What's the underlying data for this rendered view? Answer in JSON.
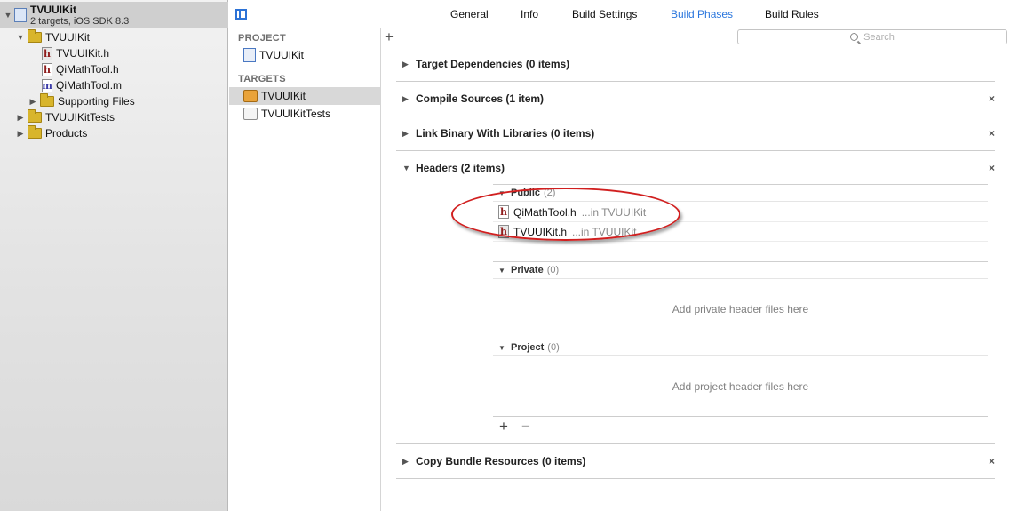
{
  "navigator": {
    "project_name": "TVUUIKit",
    "project_sub": "2 targets, iOS SDK 8.3",
    "items": [
      {
        "label": "TVUUIKit"
      },
      {
        "label": "TVUUIKit.h"
      },
      {
        "label": "QiMathTool.h"
      },
      {
        "label": "QiMathTool.m"
      },
      {
        "label": "Supporting Files"
      },
      {
        "label": "TVUUIKitTests"
      },
      {
        "label": "Products"
      }
    ]
  },
  "tabs": [
    {
      "label": "General"
    },
    {
      "label": "Info"
    },
    {
      "label": "Build Settings"
    },
    {
      "label": "Build Phases"
    },
    {
      "label": "Build Rules"
    }
  ],
  "target_list": {
    "project_section": "PROJECT",
    "project_item": "TVUUIKit",
    "targets_section": "TARGETS",
    "targets": [
      {
        "label": "TVUUIKit"
      },
      {
        "label": "TVUUIKitTests"
      }
    ]
  },
  "filter": {
    "add_symbol": "+",
    "search_placeholder": "Search"
  },
  "phases": [
    {
      "title": "Target Dependencies (0 items)"
    },
    {
      "title": "Compile Sources (1 item)"
    },
    {
      "title": "Link Binary With Libraries (0 items)"
    },
    {
      "title": "Headers (2 items)"
    },
    {
      "title": "Copy Bundle Resources (0 items)"
    }
  ],
  "headers": {
    "public": {
      "name": "Public",
      "count": "(2)"
    },
    "public_files": [
      {
        "name": "QiMathTool.h",
        "location": "...in TVUUIKit"
      },
      {
        "name": "TVUUIKit.h",
        "location": "...in TVUUIKit"
      }
    ],
    "private": {
      "name": "Private",
      "count": "(0)",
      "placeholder": "Add private header files here"
    },
    "project": {
      "name": "Project",
      "count": "(0)",
      "placeholder": "Add project header files here"
    },
    "add_symbol": "+",
    "remove_symbol": "−"
  },
  "glyphs": {
    "disclosure_open": "▼",
    "disclosure_closed": "▶",
    "close": "×",
    "h_letter": "h",
    "m_letter": "m"
  },
  "colors": {
    "accent": "#2a76dd",
    "annotation": "#d11f1f",
    "folder": "#d8b52c"
  }
}
